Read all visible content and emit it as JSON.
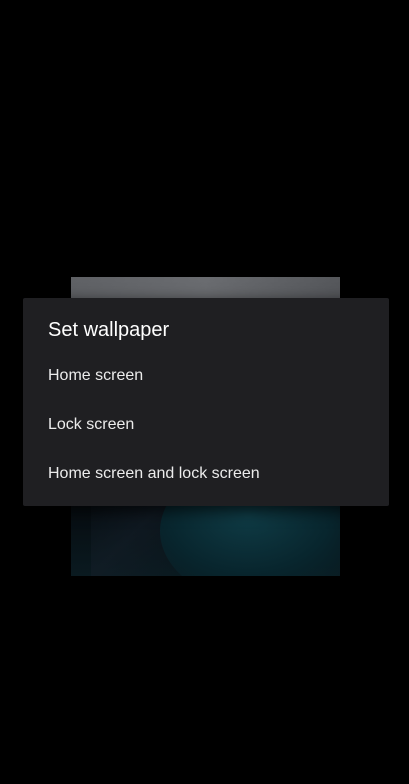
{
  "dialog": {
    "title": "Set wallpaper",
    "options": [
      {
        "label": "Home screen"
      },
      {
        "label": "Lock screen"
      },
      {
        "label": "Home screen and lock screen"
      }
    ]
  },
  "colors": {
    "background": "#000000",
    "dialog_background": "#1f1f22",
    "text_primary": "#ffffff"
  }
}
